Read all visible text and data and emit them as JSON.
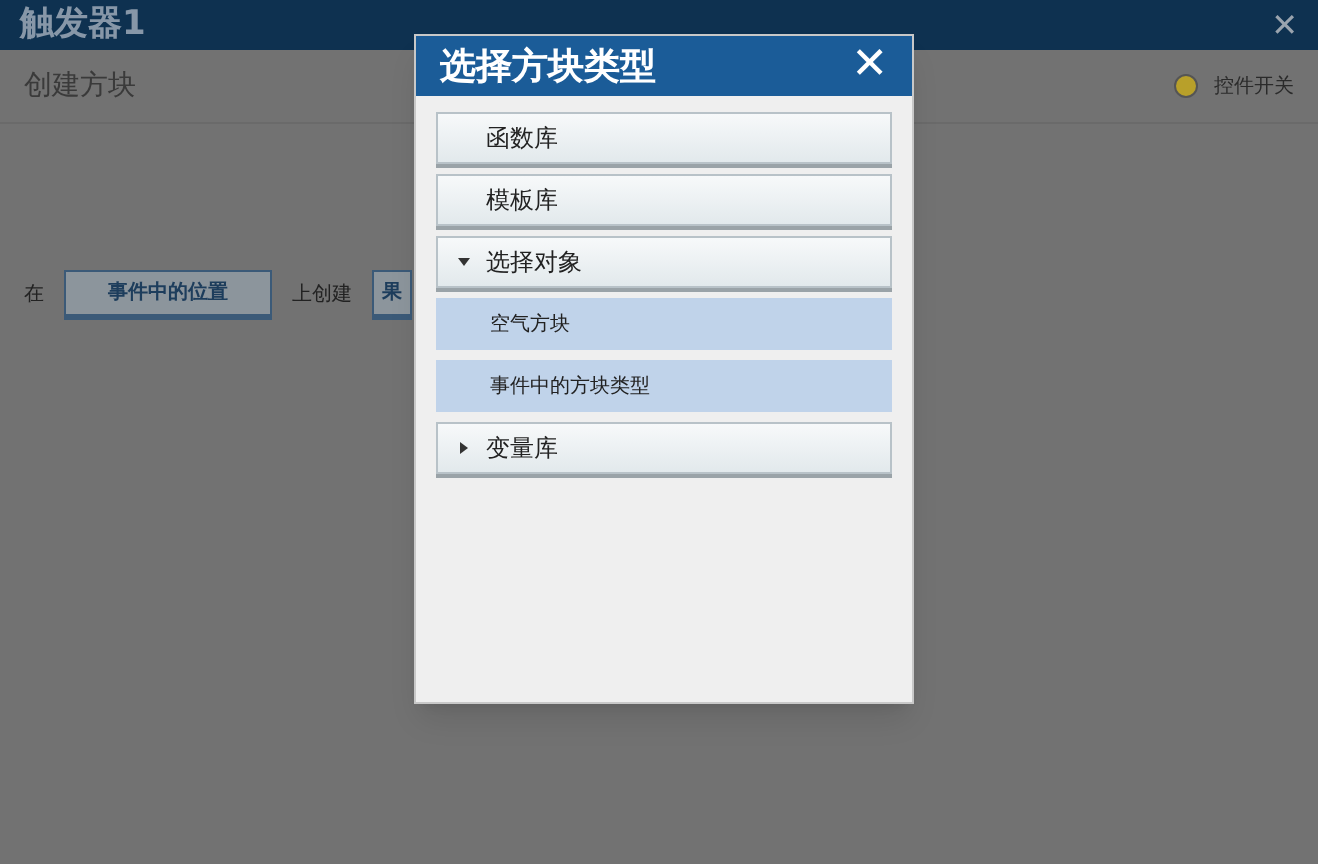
{
  "window": {
    "title": "触发器1",
    "close": "✕"
  },
  "section": {
    "title": "创建方块",
    "toggle": {
      "label": "控件开关",
      "on": true
    }
  },
  "create_row": [
    {
      "kind": "text",
      "label": "在"
    },
    {
      "kind": "button",
      "label": "事件中的位置"
    },
    {
      "kind": "text",
      "label": "上创建"
    },
    {
      "kind": "button",
      "label": "果"
    }
  ],
  "dialog": {
    "title": "选择方块类型",
    "close": "✕",
    "items": [
      {
        "label": "函数库"
      },
      {
        "label": "模板库"
      },
      {
        "label": "选择对象",
        "expanded": true,
        "children": [
          {
            "label": "空气方块"
          },
          {
            "label": "事件中的方块类型"
          }
        ]
      },
      {
        "label": "变量库",
        "expanded": false
      }
    ]
  }
}
